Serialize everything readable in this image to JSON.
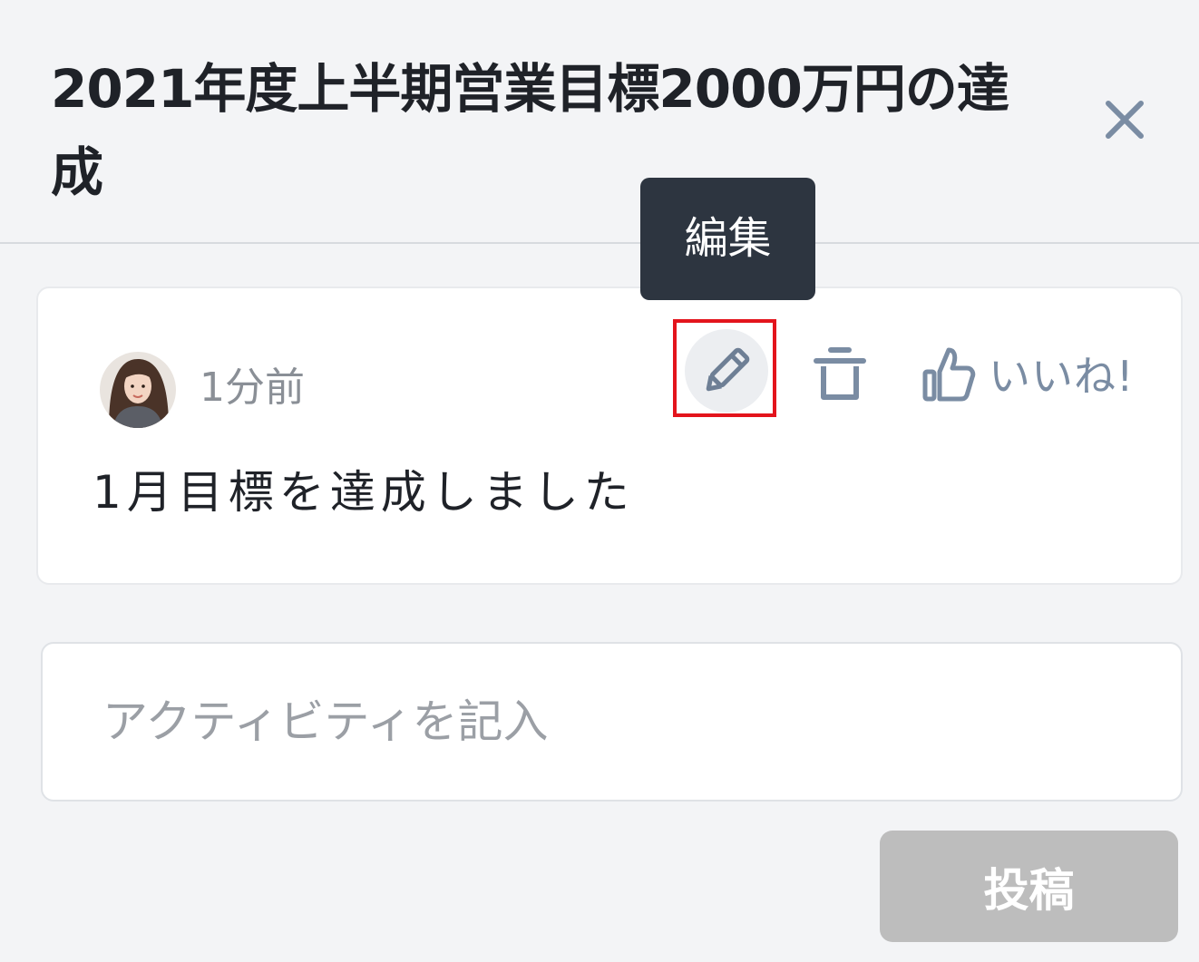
{
  "panel": {
    "title": "2021年度上半期営業目標2000万円の達成",
    "close_icon": "close-icon"
  },
  "tooltip": {
    "label": "編集"
  },
  "activity": {
    "avatar_icon": "avatar",
    "time": "1分前",
    "edit_icon": "pencil-icon",
    "delete_icon": "trash-icon",
    "like_icon": "thumbs-up-icon",
    "like_label": "いいね!",
    "text": "1月目標を達成しました"
  },
  "composer": {
    "placeholder": "アクティビティを記入",
    "value": "",
    "submit_label": "投稿"
  },
  "colors": {
    "background": "#f3f4f6",
    "icon": "#7a8ca3",
    "tooltip": "#2d3540",
    "highlight": "#e3141c",
    "submit_disabled": "#bdbdbd"
  }
}
